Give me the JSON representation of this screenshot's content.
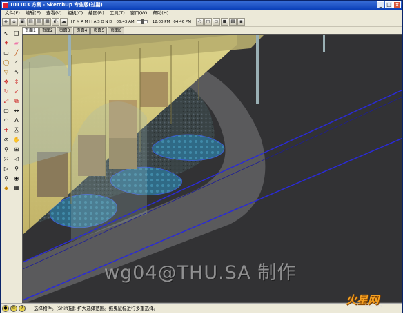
{
  "window": {
    "title": "101103 方案 - SketchUp 专业版(过期)",
    "buttons": [
      "_",
      "□",
      "×"
    ]
  },
  "menubar": {
    "items": [
      "文件(F)",
      "编辑(E)",
      "查看(V)",
      "相机(C)",
      "绘图(R)",
      "工具(T)",
      "窗口(W)",
      "帮助(H)"
    ]
  },
  "toolbar": {
    "months": [
      "J",
      "F",
      "M",
      "A",
      "M",
      "J",
      "J",
      "A",
      "S",
      "O",
      "N",
      "D"
    ],
    "time_start": "06:43 AM",
    "time_noon": "12:00 PM",
    "time_end": "04:46 PM"
  },
  "tabs": [
    "页面1",
    "页面2",
    "页面3",
    "页面4",
    "页面5",
    "页面6"
  ],
  "statusbar": {
    "text": "选择物件。[Shift]键: 扩大选择范围。拖曳鼠标进行多重选择。"
  },
  "overlay": {
    "watermark": "wg04@THU.SA 制作",
    "logo": "火星网",
    "logo_url": "hxsd.com"
  },
  "colors": {
    "title_bar": "#0a3fb8",
    "glass_yellow": "#ddd27a",
    "road_blue": "#2a2ad8"
  }
}
